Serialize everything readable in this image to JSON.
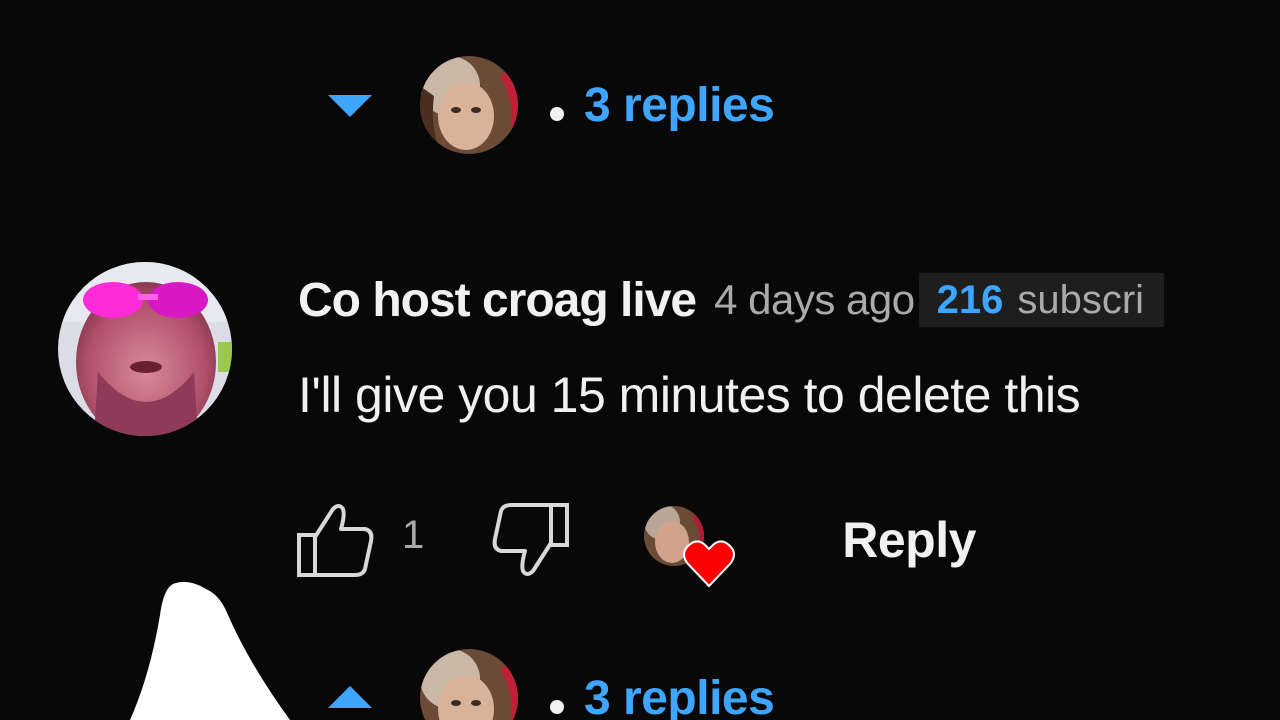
{
  "thread": {
    "replies_label": "3 replies",
    "collapsed_replies_label": "3 replies"
  },
  "comment": {
    "author": "Co host croag live",
    "time": "4 days ago",
    "subscriber_count": "216",
    "subscriber_word": "subscri",
    "text": "I'll give you 15 minutes to delete this",
    "like_count": "1",
    "reply_label": "Reply"
  },
  "colors": {
    "background": "#080808",
    "link_blue": "#3ea6ff",
    "text_primary": "#f1f1f1",
    "text_secondary": "#aaaaaa",
    "heart_red": "#ff0000",
    "badge_bg": "#1e1e1e"
  },
  "icons": {
    "expand": "caret-down-icon",
    "collapse": "caret-up-icon",
    "like": "thumbs-up-icon",
    "dislike": "thumbs-down-icon",
    "creator_heart": "heart-icon"
  }
}
